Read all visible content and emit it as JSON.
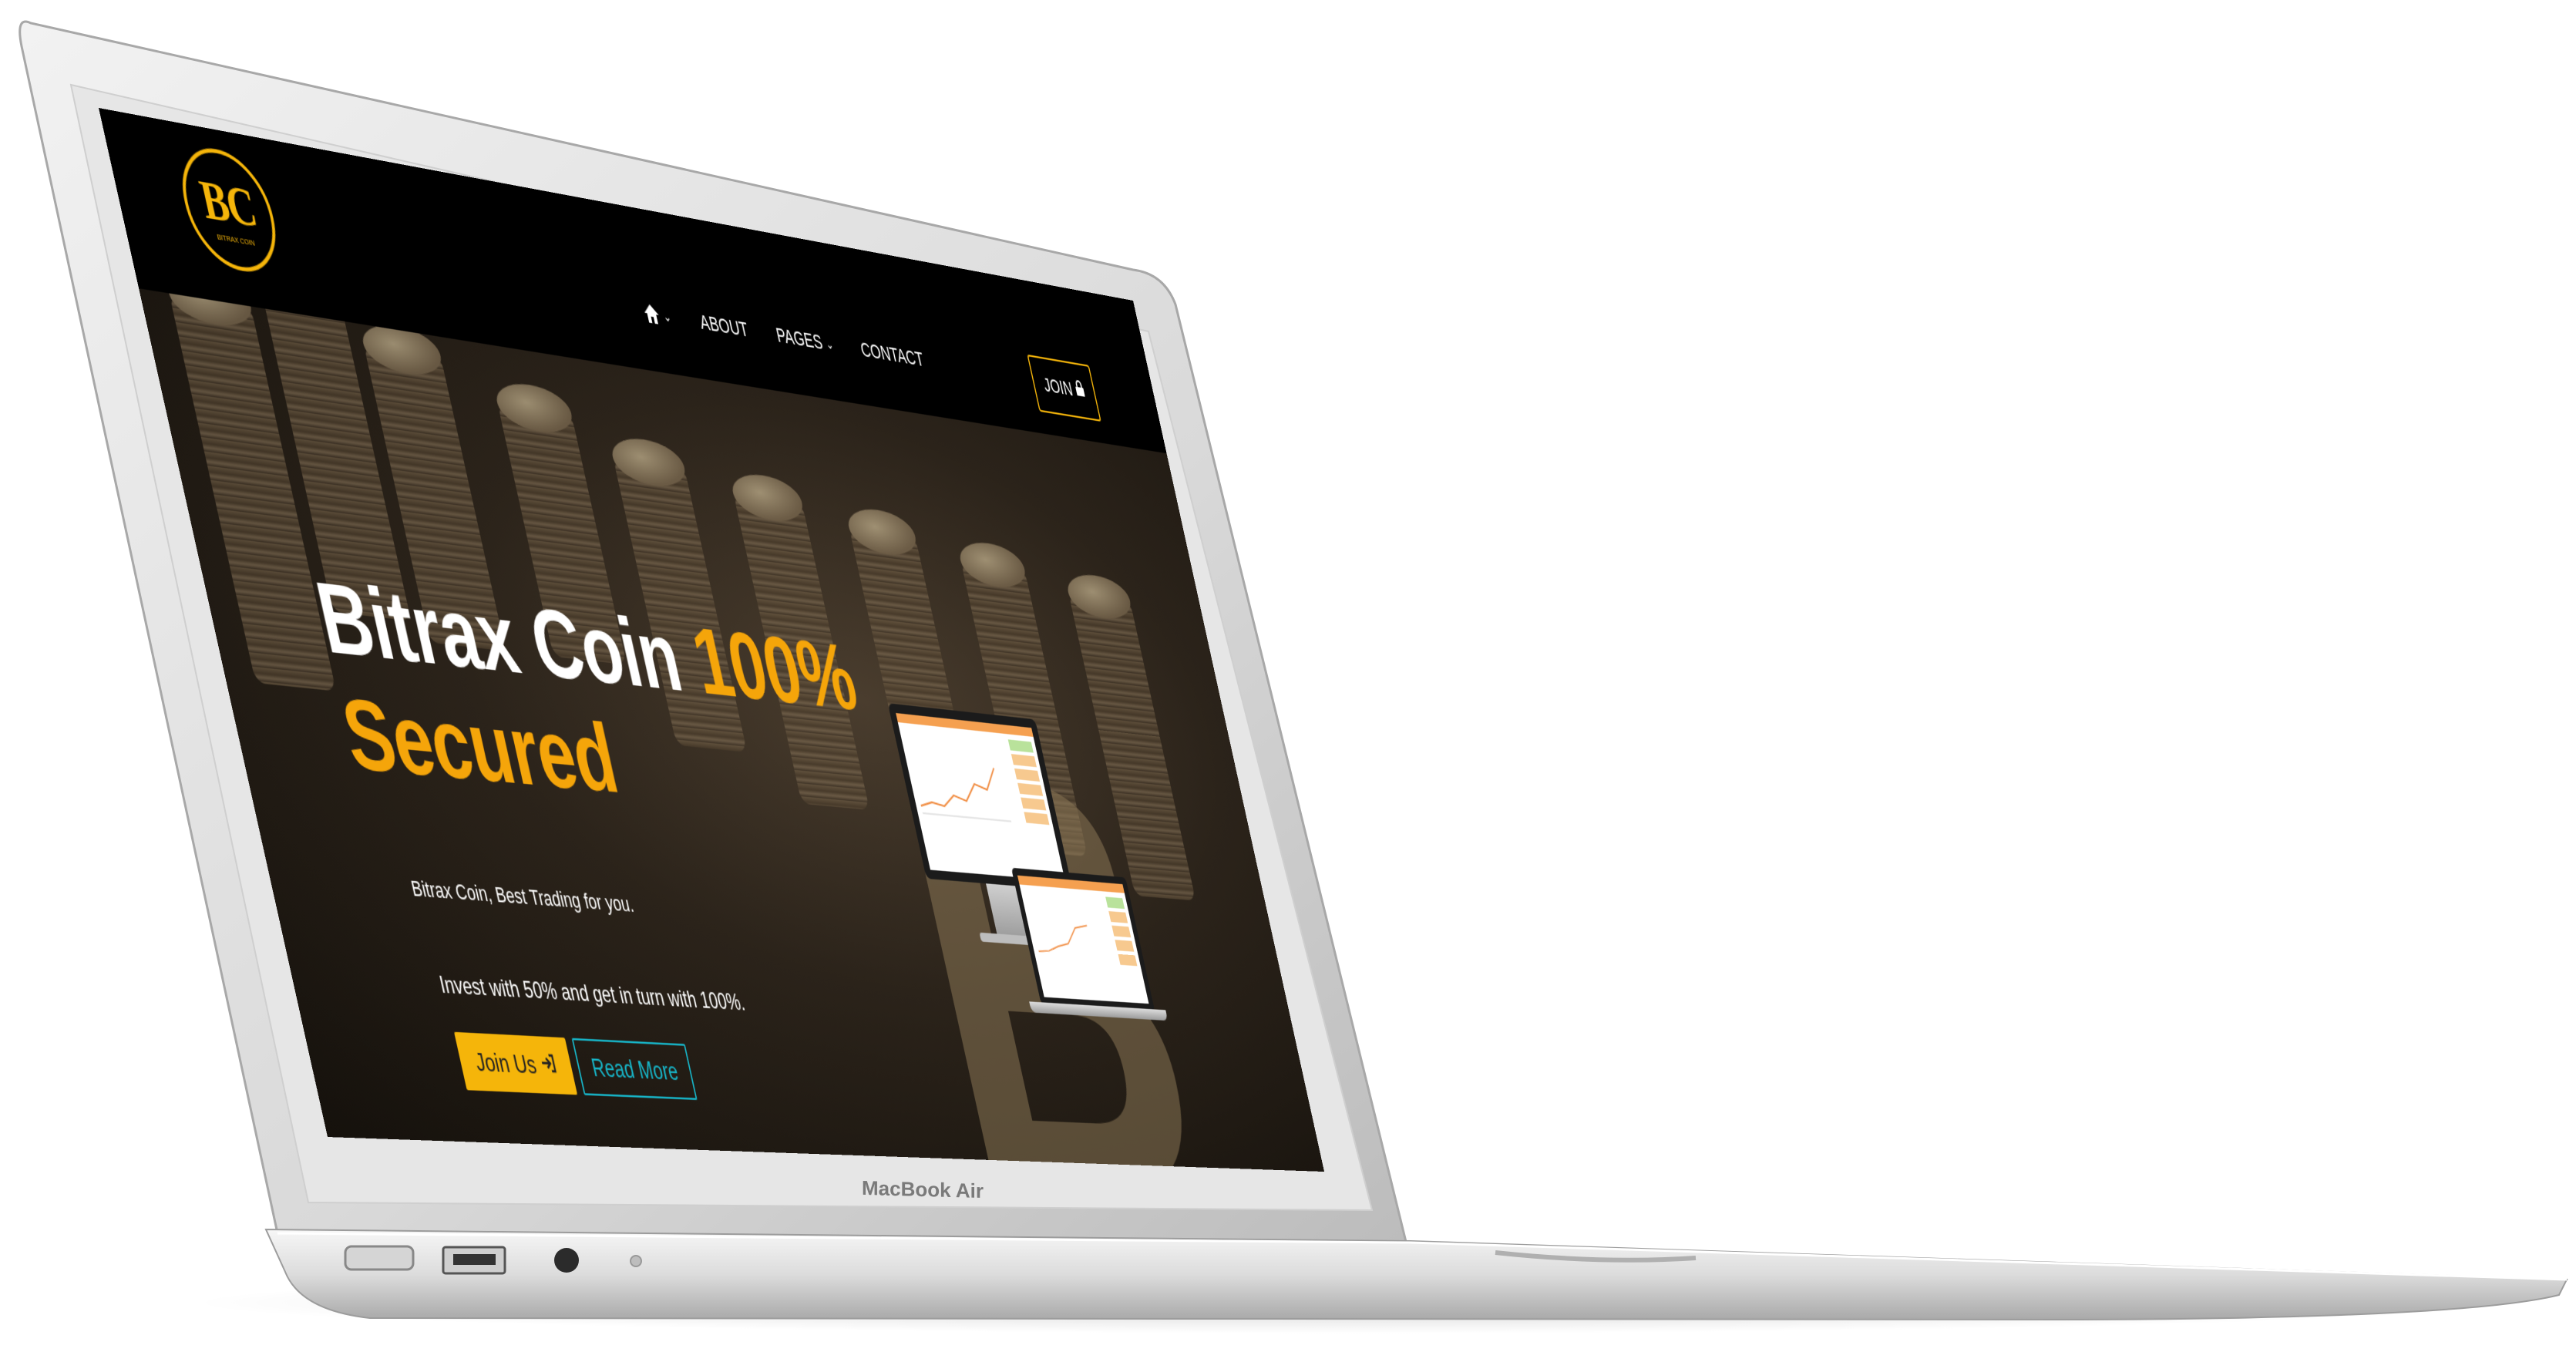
{
  "device": {
    "model_label": "MacBook Air"
  },
  "site": {
    "logo": {
      "text": "BC",
      "subtext": "BITRAX COIN"
    },
    "nav": {
      "home_icon": "home-icon",
      "items": [
        {
          "label": "ABOUT",
          "has_dropdown": false
        },
        {
          "label": "PAGES",
          "has_dropdown": true
        },
        {
          "label": "CONTACT",
          "has_dropdown": false
        }
      ],
      "join_label": "JOIN",
      "join_icon": "lock-icon"
    },
    "hero": {
      "title_white": "Bitrax Coin ",
      "title_accent_1": "100%",
      "title_accent_2": "Secured",
      "subtitle": "Bitrax Coin, Best Trading for you.",
      "invest_text": "Invest with 50% and get in turn with 100%.",
      "join_us_label": "Join Us",
      "join_us_icon": "sign-in-icon",
      "read_more_label": "Read More"
    },
    "colors": {
      "accent": "#f5a50a",
      "header_bg": "#000000",
      "read_more": "#17b5c8"
    }
  }
}
